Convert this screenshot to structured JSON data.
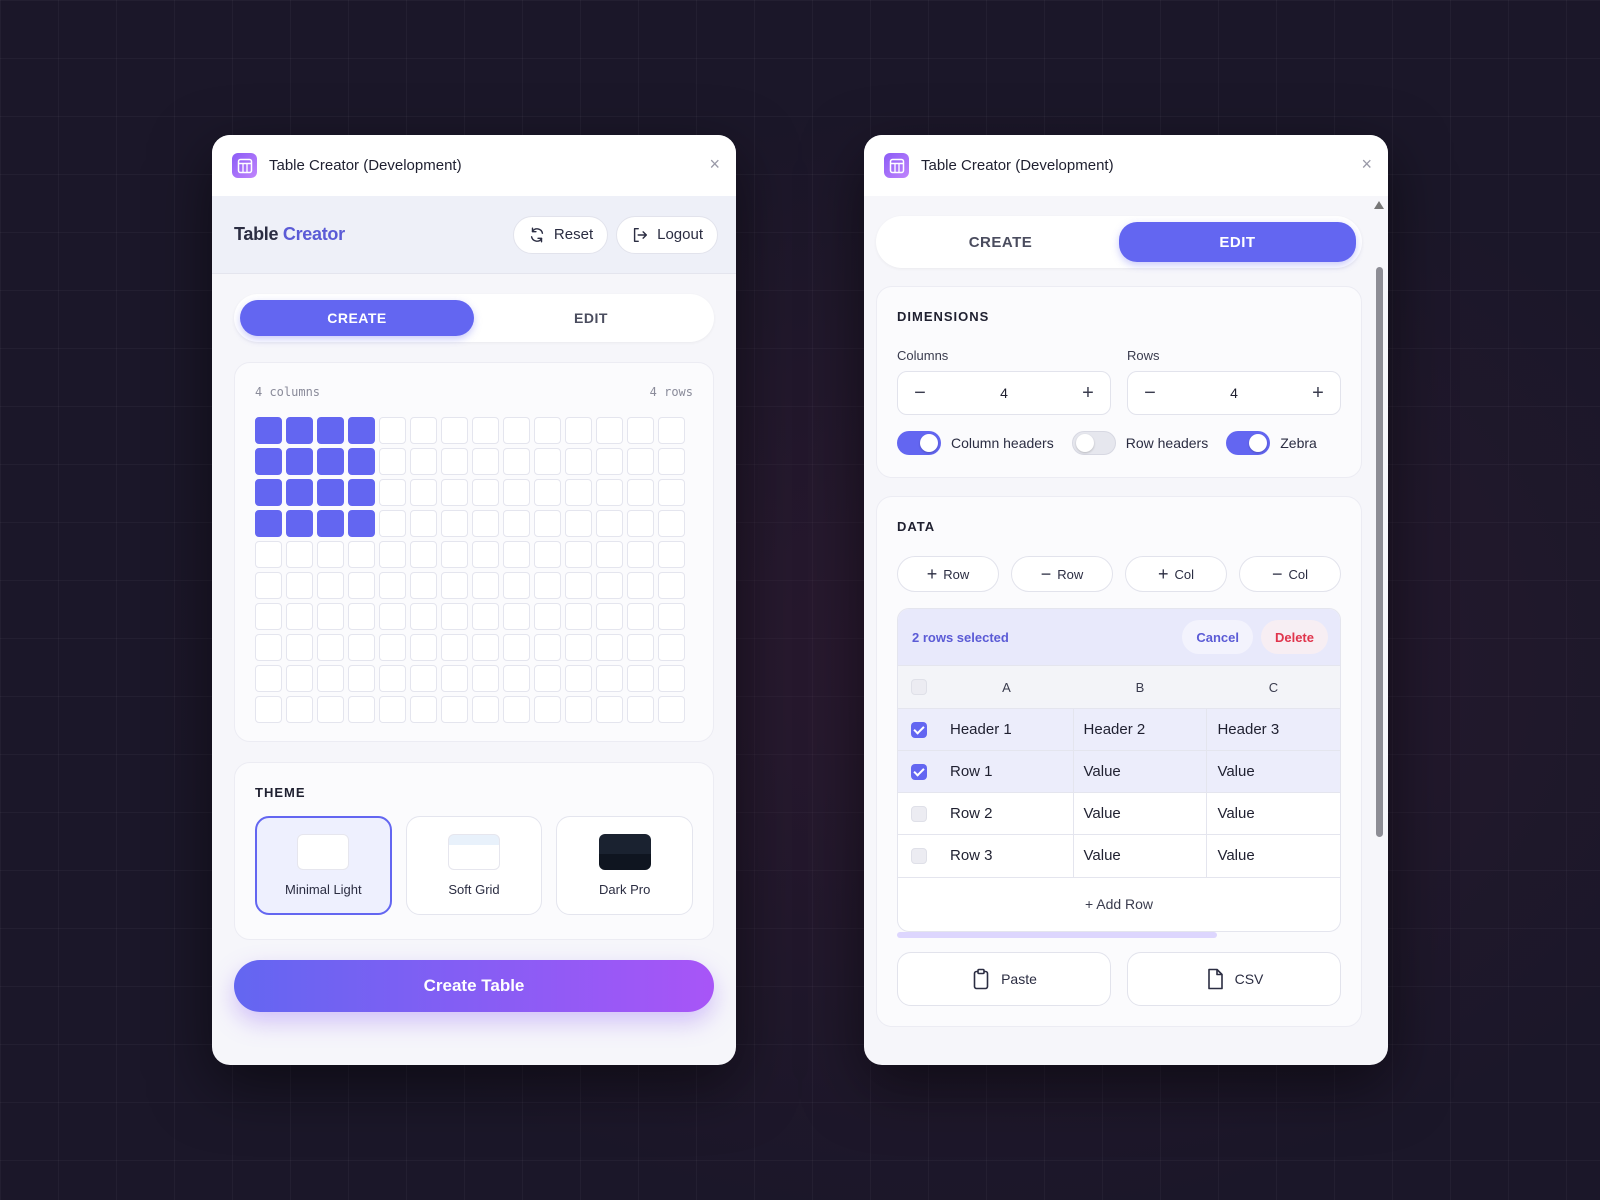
{
  "left_window": {
    "title": "Table Creator (Development)",
    "close_glyph": "×",
    "brand": {
      "part1": "Table",
      "part2": "Creator"
    },
    "reset_label": "Reset",
    "logout_label": "Logout",
    "tabs": [
      {
        "label": "CREATE",
        "active": true
      },
      {
        "label": "EDIT",
        "active": false
      }
    ],
    "grid": {
      "columns_label": "4 columns",
      "rows_label": "4 rows",
      "selected_columns": 4,
      "selected_rows": 4,
      "total_columns": 14,
      "total_rows": 10
    },
    "theme": {
      "title": "THEME",
      "options": [
        {
          "label": "Minimal Light",
          "selected": true
        },
        {
          "label": "Soft Grid",
          "selected": false
        },
        {
          "label": "Dark Pro",
          "selected": false
        }
      ]
    },
    "create_button": "Create Table"
  },
  "right_window": {
    "title": "Table Creator (Development)",
    "close_glyph": "×",
    "tabs": [
      {
        "label": "CREATE",
        "active": false
      },
      {
        "label": "EDIT",
        "active": true
      }
    ],
    "dimensions": {
      "title": "DIMENSIONS",
      "columns_label": "Columns",
      "columns_value": "4",
      "rows_label": "Rows",
      "rows_value": "4",
      "minus": "−",
      "plus": "+",
      "toggles": [
        {
          "label": "Column headers",
          "on": true
        },
        {
          "label": "Row headers",
          "on": false
        },
        {
          "label": "Zebra",
          "on": true
        }
      ]
    },
    "data": {
      "title": "DATA",
      "actions": [
        {
          "sym": "+",
          "label": "Row"
        },
        {
          "sym": "−",
          "label": "Row"
        },
        {
          "sym": "+",
          "label": "Col"
        },
        {
          "sym": "−",
          "label": "Col"
        }
      ],
      "selection_text": "2 rows selected",
      "cancel_label": "Cancel",
      "delete_label": "Delete",
      "columns": [
        "A",
        "B",
        "C"
      ],
      "rows": [
        {
          "checked": true,
          "cells": [
            "Header 1",
            "Header 2",
            "Header 3"
          ]
        },
        {
          "checked": true,
          "cells": [
            "Row 1",
            "Value",
            "Value"
          ]
        },
        {
          "checked": false,
          "cells": [
            "Row 2",
            "Value",
            "Value"
          ]
        },
        {
          "checked": false,
          "cells": [
            "Row 3",
            "Value",
            "Value"
          ]
        }
      ],
      "add_row_label": "+ Add Row"
    },
    "paste_label": "Paste",
    "csv_label": "CSV"
  },
  "colors": {
    "accent": "#6366f1",
    "accent_end": "#a855f7",
    "danger": "#e0344c"
  }
}
